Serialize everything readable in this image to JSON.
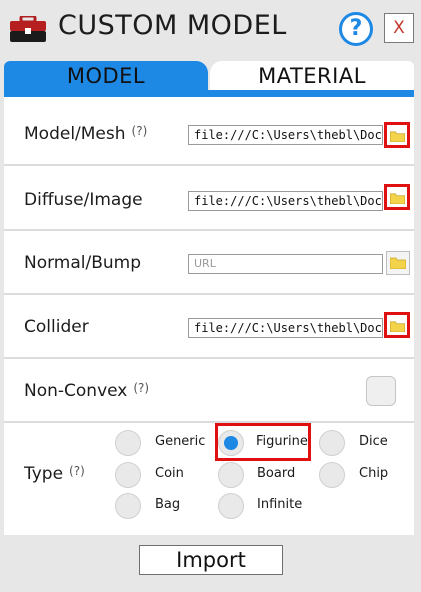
{
  "window": {
    "title": "CUSTOM MODEL",
    "icon": "toolbox-icon",
    "help_label": "?",
    "close_label": "X"
  },
  "tabs": [
    {
      "label": "MODEL",
      "active": true
    },
    {
      "label": "MATERIAL",
      "active": false
    }
  ],
  "fields": {
    "model_mesh": {
      "label": "Model/Mesh",
      "hint": "(?)",
      "value": "file:///C:\\Users\\thebl\\Docum",
      "highlighted": true
    },
    "diffuse_image": {
      "label": "Diffuse/Image",
      "value": "file:///C:\\Users\\thebl\\Docum",
      "highlighted": true
    },
    "normal_bump": {
      "label": "Normal/Bump",
      "value": "",
      "placeholder": "URL",
      "highlighted": false
    },
    "collider": {
      "label": "Collider",
      "value": "file:///C:\\Users\\thebl\\Docum",
      "highlighted": true
    }
  },
  "non_convex": {
    "label": "Non-Convex",
    "hint": "(?)",
    "checked": false
  },
  "type": {
    "label": "Type",
    "hint": "(?)",
    "selected": "Figurine",
    "options": [
      "Generic",
      "Figurine",
      "Dice",
      "Coin",
      "Board",
      "Chip",
      "Bag",
      "Infinite"
    ]
  },
  "import_label": "Import",
  "colors": {
    "accent": "#1e88e5",
    "highlight": "#e01010",
    "folder": "#f2d34a",
    "background": "#e7e7e7"
  }
}
